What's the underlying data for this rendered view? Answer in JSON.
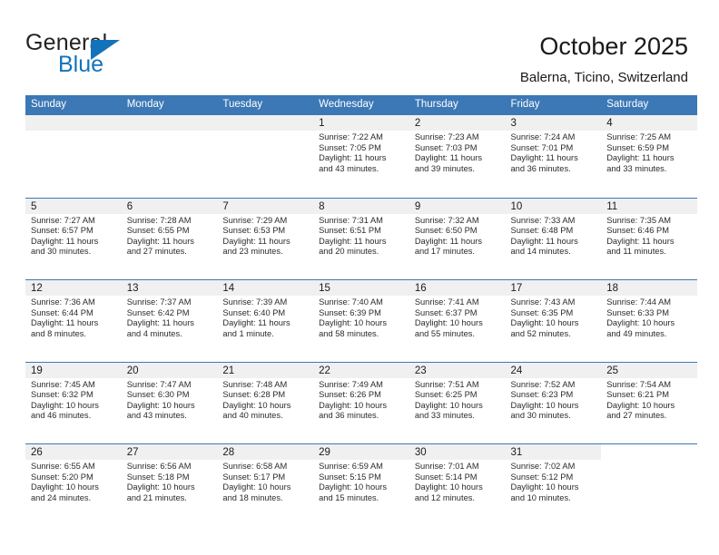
{
  "logo": {
    "word1": "General",
    "word2": "Blue",
    "triangle_color": "#1373ba",
    "icon": "general-blue-logo"
  },
  "header": {
    "title": "October 2025",
    "subtitle": "Balerna, Ticino, Switzerland"
  },
  "colors": {
    "header_bar": "#3c78b5",
    "daynum_band": "#f0f0f0",
    "text": "#2b2b2b",
    "accent_blue": "#1373ba"
  },
  "calendar": {
    "weekday_headers": [
      "Sunday",
      "Monday",
      "Tuesday",
      "Wednesday",
      "Thursday",
      "Friday",
      "Saturday"
    ],
    "weeks": [
      [
        {
          "day": "",
          "lines": []
        },
        {
          "day": "",
          "lines": []
        },
        {
          "day": "",
          "lines": []
        },
        {
          "day": "1",
          "lines": [
            "Sunrise: 7:22 AM",
            "Sunset: 7:05 PM",
            "Daylight: 11 hours",
            "and 43 minutes."
          ]
        },
        {
          "day": "2",
          "lines": [
            "Sunrise: 7:23 AM",
            "Sunset: 7:03 PM",
            "Daylight: 11 hours",
            "and 39 minutes."
          ]
        },
        {
          "day": "3",
          "lines": [
            "Sunrise: 7:24 AM",
            "Sunset: 7:01 PM",
            "Daylight: 11 hours",
            "and 36 minutes."
          ]
        },
        {
          "day": "4",
          "lines": [
            "Sunrise: 7:25 AM",
            "Sunset: 6:59 PM",
            "Daylight: 11 hours",
            "and 33 minutes."
          ]
        }
      ],
      [
        {
          "day": "5",
          "lines": [
            "Sunrise: 7:27 AM",
            "Sunset: 6:57 PM",
            "Daylight: 11 hours",
            "and 30 minutes."
          ]
        },
        {
          "day": "6",
          "lines": [
            "Sunrise: 7:28 AM",
            "Sunset: 6:55 PM",
            "Daylight: 11 hours",
            "and 27 minutes."
          ]
        },
        {
          "day": "7",
          "lines": [
            "Sunrise: 7:29 AM",
            "Sunset: 6:53 PM",
            "Daylight: 11 hours",
            "and 23 minutes."
          ]
        },
        {
          "day": "8",
          "lines": [
            "Sunrise: 7:31 AM",
            "Sunset: 6:51 PM",
            "Daylight: 11 hours",
            "and 20 minutes."
          ]
        },
        {
          "day": "9",
          "lines": [
            "Sunrise: 7:32 AM",
            "Sunset: 6:50 PM",
            "Daylight: 11 hours",
            "and 17 minutes."
          ]
        },
        {
          "day": "10",
          "lines": [
            "Sunrise: 7:33 AM",
            "Sunset: 6:48 PM",
            "Daylight: 11 hours",
            "and 14 minutes."
          ]
        },
        {
          "day": "11",
          "lines": [
            "Sunrise: 7:35 AM",
            "Sunset: 6:46 PM",
            "Daylight: 11 hours",
            "and 11 minutes."
          ]
        }
      ],
      [
        {
          "day": "12",
          "lines": [
            "Sunrise: 7:36 AM",
            "Sunset: 6:44 PM",
            "Daylight: 11 hours",
            "and 8 minutes."
          ]
        },
        {
          "day": "13",
          "lines": [
            "Sunrise: 7:37 AM",
            "Sunset: 6:42 PM",
            "Daylight: 11 hours",
            "and 4 minutes."
          ]
        },
        {
          "day": "14",
          "lines": [
            "Sunrise: 7:39 AM",
            "Sunset: 6:40 PM",
            "Daylight: 11 hours",
            "and 1 minute."
          ]
        },
        {
          "day": "15",
          "lines": [
            "Sunrise: 7:40 AM",
            "Sunset: 6:39 PM",
            "Daylight: 10 hours",
            "and 58 minutes."
          ]
        },
        {
          "day": "16",
          "lines": [
            "Sunrise: 7:41 AM",
            "Sunset: 6:37 PM",
            "Daylight: 10 hours",
            "and 55 minutes."
          ]
        },
        {
          "day": "17",
          "lines": [
            "Sunrise: 7:43 AM",
            "Sunset: 6:35 PM",
            "Daylight: 10 hours",
            "and 52 minutes."
          ]
        },
        {
          "day": "18",
          "lines": [
            "Sunrise: 7:44 AM",
            "Sunset: 6:33 PM",
            "Daylight: 10 hours",
            "and 49 minutes."
          ]
        }
      ],
      [
        {
          "day": "19",
          "lines": [
            "Sunrise: 7:45 AM",
            "Sunset: 6:32 PM",
            "Daylight: 10 hours",
            "and 46 minutes."
          ]
        },
        {
          "day": "20",
          "lines": [
            "Sunrise: 7:47 AM",
            "Sunset: 6:30 PM",
            "Daylight: 10 hours",
            "and 43 minutes."
          ]
        },
        {
          "day": "21",
          "lines": [
            "Sunrise: 7:48 AM",
            "Sunset: 6:28 PM",
            "Daylight: 10 hours",
            "and 40 minutes."
          ]
        },
        {
          "day": "22",
          "lines": [
            "Sunrise: 7:49 AM",
            "Sunset: 6:26 PM",
            "Daylight: 10 hours",
            "and 36 minutes."
          ]
        },
        {
          "day": "23",
          "lines": [
            "Sunrise: 7:51 AM",
            "Sunset: 6:25 PM",
            "Daylight: 10 hours",
            "and 33 minutes."
          ]
        },
        {
          "day": "24",
          "lines": [
            "Sunrise: 7:52 AM",
            "Sunset: 6:23 PM",
            "Daylight: 10 hours",
            "and 30 minutes."
          ]
        },
        {
          "day": "25",
          "lines": [
            "Sunrise: 7:54 AM",
            "Sunset: 6:21 PM",
            "Daylight: 10 hours",
            "and 27 minutes."
          ]
        }
      ],
      [
        {
          "day": "26",
          "lines": [
            "Sunrise: 6:55 AM",
            "Sunset: 5:20 PM",
            "Daylight: 10 hours",
            "and 24 minutes."
          ]
        },
        {
          "day": "27",
          "lines": [
            "Sunrise: 6:56 AM",
            "Sunset: 5:18 PM",
            "Daylight: 10 hours",
            "and 21 minutes."
          ]
        },
        {
          "day": "28",
          "lines": [
            "Sunrise: 6:58 AM",
            "Sunset: 5:17 PM",
            "Daylight: 10 hours",
            "and 18 minutes."
          ]
        },
        {
          "day": "29",
          "lines": [
            "Sunrise: 6:59 AM",
            "Sunset: 5:15 PM",
            "Daylight: 10 hours",
            "and 15 minutes."
          ]
        },
        {
          "day": "30",
          "lines": [
            "Sunrise: 7:01 AM",
            "Sunset: 5:14 PM",
            "Daylight: 10 hours",
            "and 12 minutes."
          ]
        },
        {
          "day": "31",
          "lines": [
            "Sunrise: 7:02 AM",
            "Sunset: 5:12 PM",
            "Daylight: 10 hours",
            "and 10 minutes."
          ]
        }
      ]
    ]
  }
}
